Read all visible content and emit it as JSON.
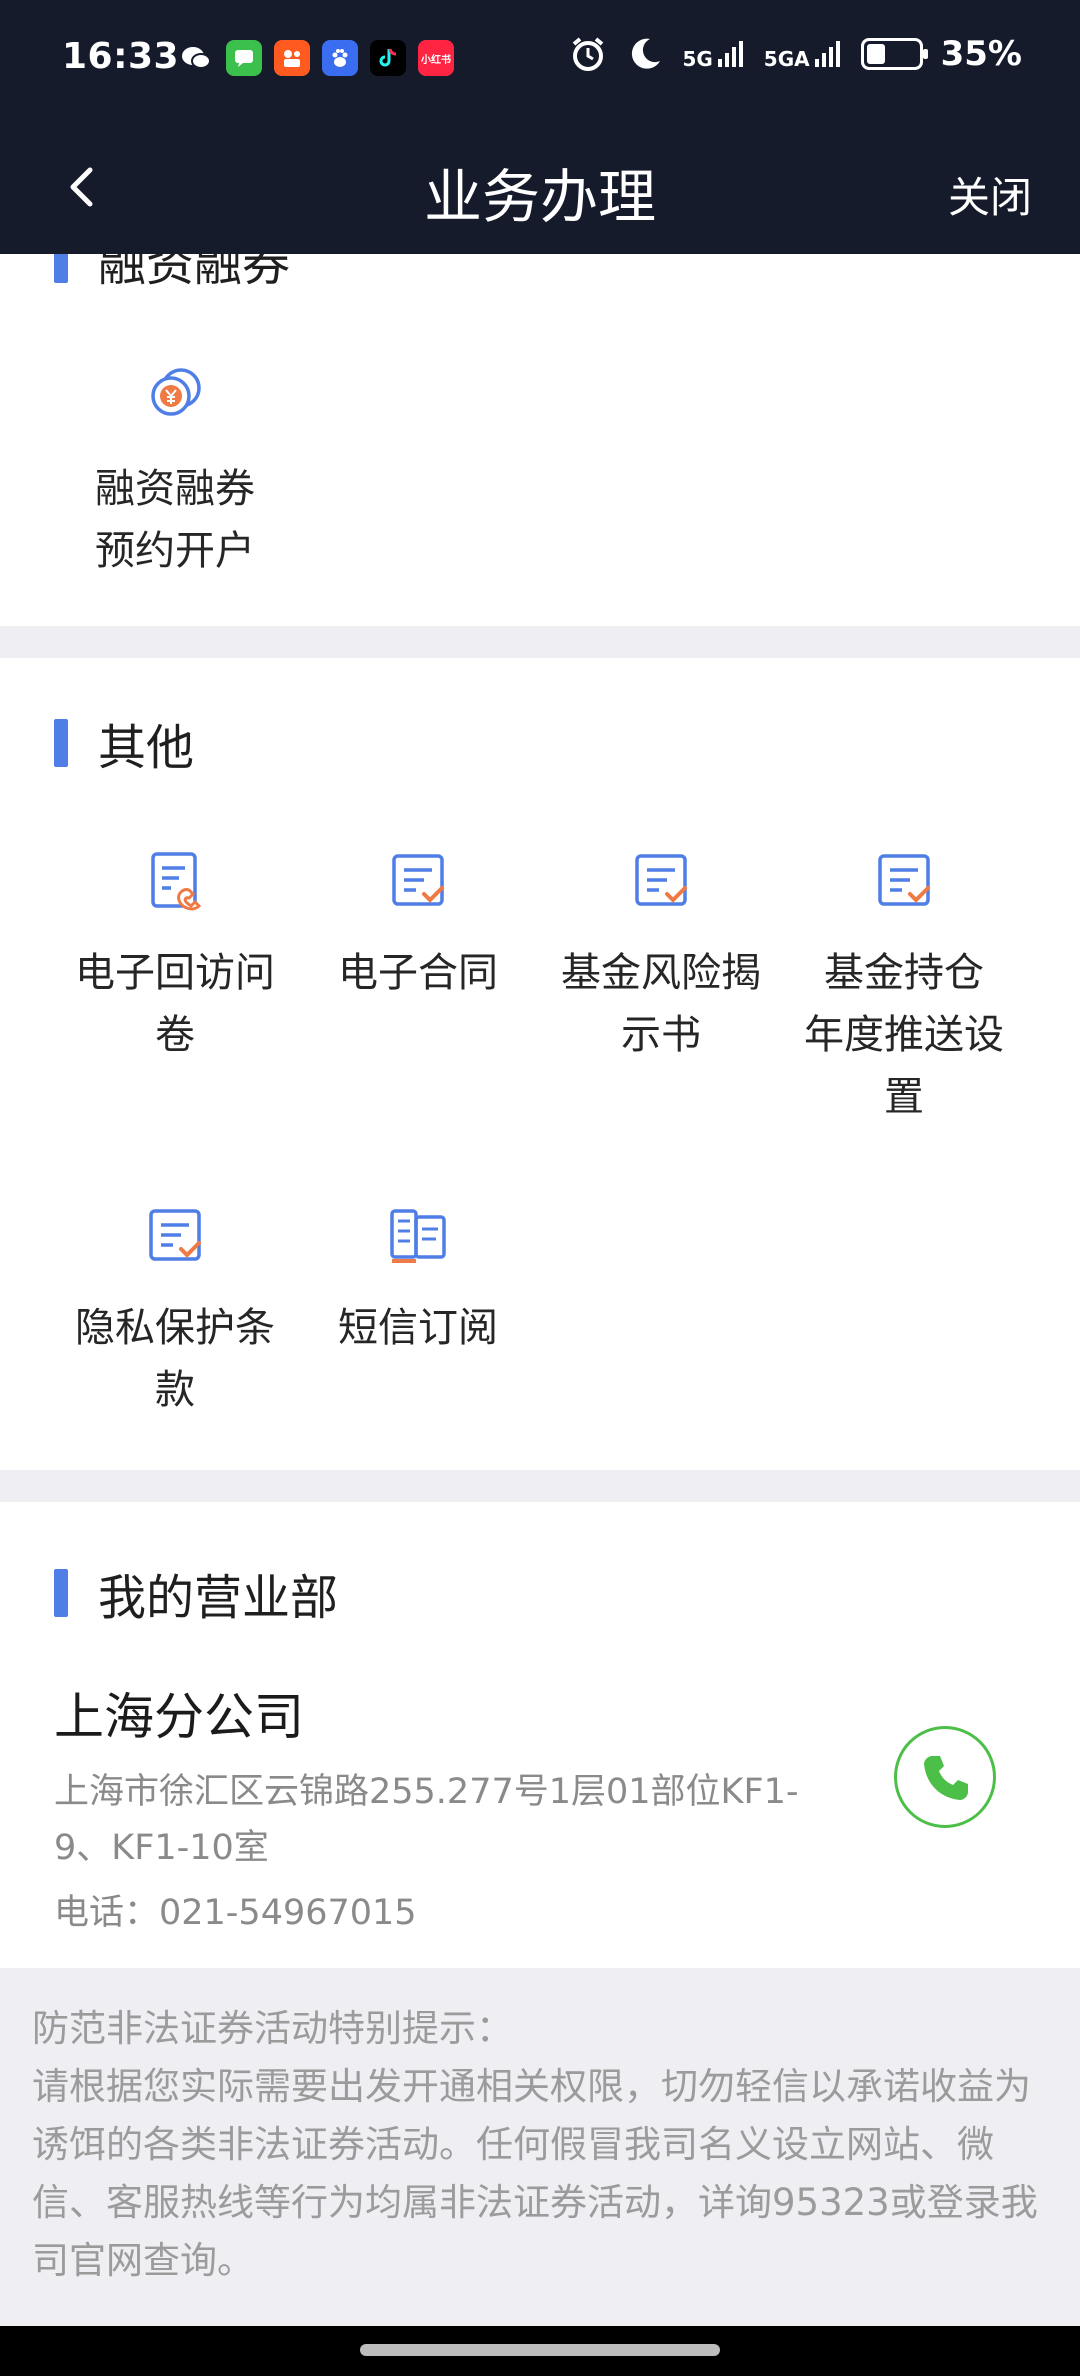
{
  "status_bar": {
    "time": "16:33",
    "notification_icons": [
      "wechat-icon",
      "messages-icon",
      "kuaishou-icon",
      "baidu-icon",
      "tiktok-icon",
      "xiaohongshu-icon"
    ],
    "xiaohongshu_label": "小红书",
    "signal_1": "5G",
    "signal_2": "5GA",
    "battery": "35%",
    "battery_level": 0.35
  },
  "navbar": {
    "title": "业务办理",
    "close_label": "关闭"
  },
  "margin_section": {
    "title": "融资融券",
    "items": [
      {
        "line1": "融资融券",
        "line2": "预约开户",
        "icon": "coin-icon"
      }
    ]
  },
  "other_section": {
    "title": "其他",
    "items": [
      {
        "line1": "电子回访问",
        "line2": "卷",
        "line3": "",
        "icon": "phone-doc-icon"
      },
      {
        "line1": "电子合同",
        "line2": "",
        "line3": "",
        "icon": "doc-check-icon"
      },
      {
        "line1": "基金风险揭",
        "line2": "示书",
        "line3": "",
        "icon": "doc-check-icon"
      },
      {
        "line1": "基金持仓",
        "line2": "年度推送设",
        "line3": "置",
        "icon": "doc-check-icon"
      },
      {
        "line1": "隐私保护条",
        "line2": "款",
        "line3": "",
        "icon": "doc-check-icon"
      },
      {
        "line1": "短信订阅",
        "line2": "",
        "line3": "",
        "icon": "newspaper-icon"
      }
    ]
  },
  "branch_section": {
    "title": "我的营业部",
    "name": "上海分公司",
    "address": "上海市徐汇区云锦路255.277号1层01部位KF1-9、KF1-10室",
    "phone": "电话：021-54967015"
  },
  "notice": {
    "title": "防范非法证券活动特别提示：",
    "body": "请根据您实际需要出发开通相关权限，切勿轻信以承诺收益为诱饵的各类非法证券活动。任何假冒我司名义设立网站、微信、客服热线等行为均属非法证券活动，详询95323或登录我司官网查询。"
  },
  "colors": {
    "header_bg": "#161b2c",
    "accent_blue": "#4f7fe6",
    "accent_orange": "#f07a45",
    "call_green": "#4cbf48"
  }
}
